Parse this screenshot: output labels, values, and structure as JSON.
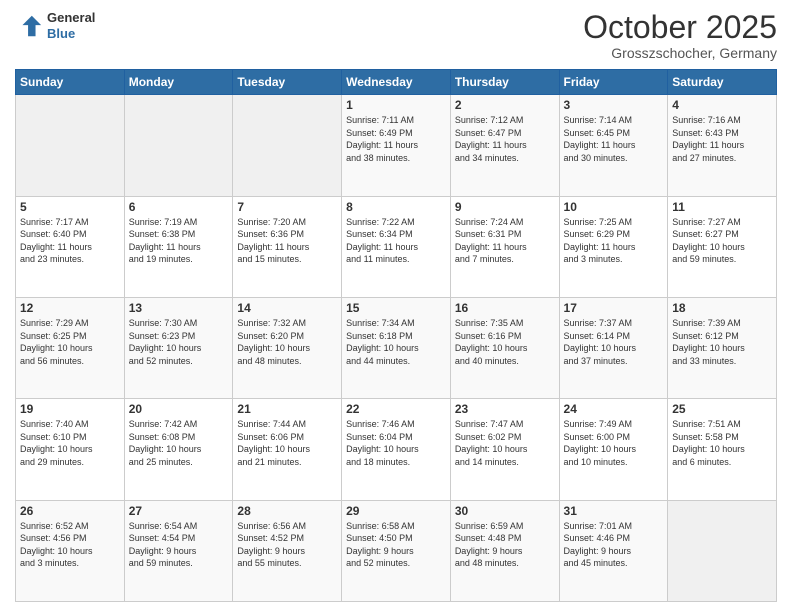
{
  "header": {
    "logo_line1": "General",
    "logo_line2": "Blue",
    "month": "October 2025",
    "location": "Grosszschocher, Germany"
  },
  "weekdays": [
    "Sunday",
    "Monday",
    "Tuesday",
    "Wednesday",
    "Thursday",
    "Friday",
    "Saturday"
  ],
  "weeks": [
    [
      {
        "day": "",
        "info": ""
      },
      {
        "day": "",
        "info": ""
      },
      {
        "day": "",
        "info": ""
      },
      {
        "day": "1",
        "info": "Sunrise: 7:11 AM\nSunset: 6:49 PM\nDaylight: 11 hours\nand 38 minutes."
      },
      {
        "day": "2",
        "info": "Sunrise: 7:12 AM\nSunset: 6:47 PM\nDaylight: 11 hours\nand 34 minutes."
      },
      {
        "day": "3",
        "info": "Sunrise: 7:14 AM\nSunset: 6:45 PM\nDaylight: 11 hours\nand 30 minutes."
      },
      {
        "day": "4",
        "info": "Sunrise: 7:16 AM\nSunset: 6:43 PM\nDaylight: 11 hours\nand 27 minutes."
      }
    ],
    [
      {
        "day": "5",
        "info": "Sunrise: 7:17 AM\nSunset: 6:40 PM\nDaylight: 11 hours\nand 23 minutes."
      },
      {
        "day": "6",
        "info": "Sunrise: 7:19 AM\nSunset: 6:38 PM\nDaylight: 11 hours\nand 19 minutes."
      },
      {
        "day": "7",
        "info": "Sunrise: 7:20 AM\nSunset: 6:36 PM\nDaylight: 11 hours\nand 15 minutes."
      },
      {
        "day": "8",
        "info": "Sunrise: 7:22 AM\nSunset: 6:34 PM\nDaylight: 11 hours\nand 11 minutes."
      },
      {
        "day": "9",
        "info": "Sunrise: 7:24 AM\nSunset: 6:31 PM\nDaylight: 11 hours\nand 7 minutes."
      },
      {
        "day": "10",
        "info": "Sunrise: 7:25 AM\nSunset: 6:29 PM\nDaylight: 11 hours\nand 3 minutes."
      },
      {
        "day": "11",
        "info": "Sunrise: 7:27 AM\nSunset: 6:27 PM\nDaylight: 10 hours\nand 59 minutes."
      }
    ],
    [
      {
        "day": "12",
        "info": "Sunrise: 7:29 AM\nSunset: 6:25 PM\nDaylight: 10 hours\nand 56 minutes."
      },
      {
        "day": "13",
        "info": "Sunrise: 7:30 AM\nSunset: 6:23 PM\nDaylight: 10 hours\nand 52 minutes."
      },
      {
        "day": "14",
        "info": "Sunrise: 7:32 AM\nSunset: 6:20 PM\nDaylight: 10 hours\nand 48 minutes."
      },
      {
        "day": "15",
        "info": "Sunrise: 7:34 AM\nSunset: 6:18 PM\nDaylight: 10 hours\nand 44 minutes."
      },
      {
        "day": "16",
        "info": "Sunrise: 7:35 AM\nSunset: 6:16 PM\nDaylight: 10 hours\nand 40 minutes."
      },
      {
        "day": "17",
        "info": "Sunrise: 7:37 AM\nSunset: 6:14 PM\nDaylight: 10 hours\nand 37 minutes."
      },
      {
        "day": "18",
        "info": "Sunrise: 7:39 AM\nSunset: 6:12 PM\nDaylight: 10 hours\nand 33 minutes."
      }
    ],
    [
      {
        "day": "19",
        "info": "Sunrise: 7:40 AM\nSunset: 6:10 PM\nDaylight: 10 hours\nand 29 minutes."
      },
      {
        "day": "20",
        "info": "Sunrise: 7:42 AM\nSunset: 6:08 PM\nDaylight: 10 hours\nand 25 minutes."
      },
      {
        "day": "21",
        "info": "Sunrise: 7:44 AM\nSunset: 6:06 PM\nDaylight: 10 hours\nand 21 minutes."
      },
      {
        "day": "22",
        "info": "Sunrise: 7:46 AM\nSunset: 6:04 PM\nDaylight: 10 hours\nand 18 minutes."
      },
      {
        "day": "23",
        "info": "Sunrise: 7:47 AM\nSunset: 6:02 PM\nDaylight: 10 hours\nand 14 minutes."
      },
      {
        "day": "24",
        "info": "Sunrise: 7:49 AM\nSunset: 6:00 PM\nDaylight: 10 hours\nand 10 minutes."
      },
      {
        "day": "25",
        "info": "Sunrise: 7:51 AM\nSunset: 5:58 PM\nDaylight: 10 hours\nand 6 minutes."
      }
    ],
    [
      {
        "day": "26",
        "info": "Sunrise: 6:52 AM\nSunset: 4:56 PM\nDaylight: 10 hours\nand 3 minutes."
      },
      {
        "day": "27",
        "info": "Sunrise: 6:54 AM\nSunset: 4:54 PM\nDaylight: 9 hours\nand 59 minutes."
      },
      {
        "day": "28",
        "info": "Sunrise: 6:56 AM\nSunset: 4:52 PM\nDaylight: 9 hours\nand 55 minutes."
      },
      {
        "day": "29",
        "info": "Sunrise: 6:58 AM\nSunset: 4:50 PM\nDaylight: 9 hours\nand 52 minutes."
      },
      {
        "day": "30",
        "info": "Sunrise: 6:59 AM\nSunset: 4:48 PM\nDaylight: 9 hours\nand 48 minutes."
      },
      {
        "day": "31",
        "info": "Sunrise: 7:01 AM\nSunset: 4:46 PM\nDaylight: 9 hours\nand 45 minutes."
      },
      {
        "day": "",
        "info": ""
      }
    ]
  ]
}
